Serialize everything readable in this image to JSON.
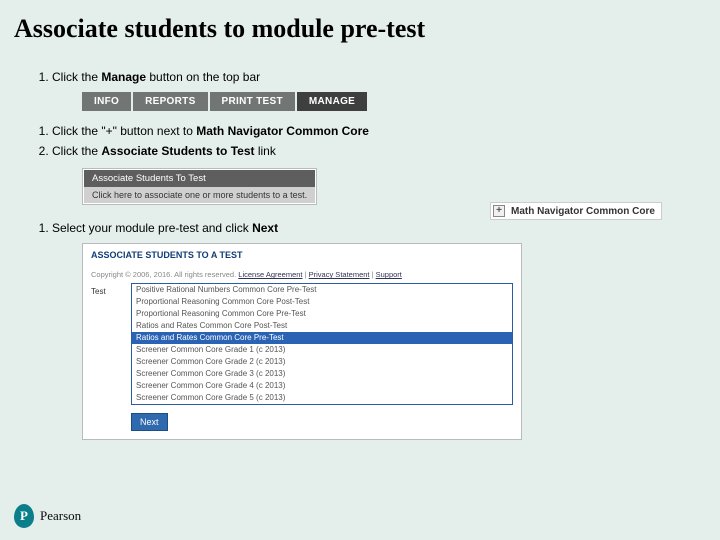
{
  "title": "Associate students to module pre-test",
  "steps_a": [
    "Click the <b>Manage</b> button on the top bar"
  ],
  "nav": {
    "tabs": [
      "INFO",
      "REPORTS",
      "PRINT TEST",
      "MANAGE"
    ],
    "active_index": 3
  },
  "steps_b": [
    "Click the \"+\" button next to <b>Math Navigator Common Core</b>",
    "Click the <b>Associate Students to Test</b> link"
  ],
  "plus_folder": {
    "icon": "+",
    "label": "Math Navigator Common Core"
  },
  "assoc": {
    "link": "Associate Students To Test",
    "sub": "Click here to associate one or more students to a test."
  },
  "steps_c": [
    "Select your module pre-test and click <b>Next</b>"
  ],
  "testpanel": {
    "heading": "ASSOCIATE STUDENTS TO A TEST",
    "copyright": "Copyright © 2006, 2016. All rights reserved.",
    "foot_links": [
      "License Agreement",
      "Privacy Statement",
      "Support"
    ],
    "field_label": "Test",
    "options": [
      "Positive Rational Numbers Common Core Pre-Test",
      "Proportional Reasoning Common Core Post-Test",
      "Proportional Reasoning Common Core Pre-Test",
      "Ratios and Rates Common Core Post-Test",
      "Ratios and Rates Common Core Pre-Test",
      "Screener Common Core Grade 1 (c 2013)",
      "Screener Common Core Grade 2 (c 2013)",
      "Screener Common Core Grade 3 (c 2013)",
      "Screener Common Core Grade 4 (c 2013)",
      "Screener Common Core Grade 5 (c 2013)"
    ],
    "selected_index": 4,
    "next_label": "Next"
  },
  "brand": "Pearson"
}
